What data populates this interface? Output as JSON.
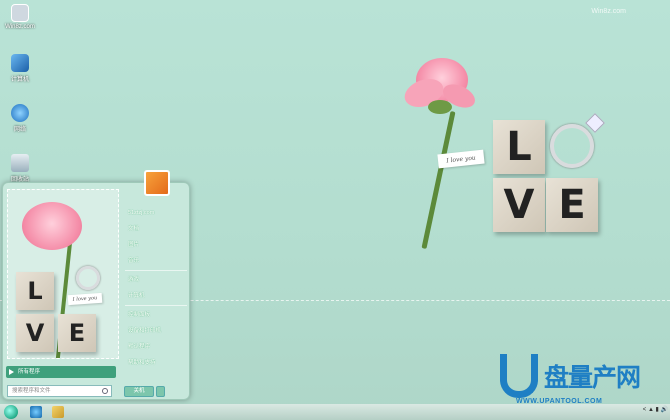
{
  "desktop": {
    "icons": [
      {
        "label": "Win8z.com",
        "name": "site-icon",
        "color": "#cfd8e0"
      },
      {
        "label": "计算机",
        "name": "computer-icon",
        "color": "#2b7fd2"
      },
      {
        "label": "网络",
        "name": "network-icon",
        "color": "#3a9fe0"
      },
      {
        "label": "回收站",
        "name": "recycle-bin-icon",
        "color": "#9ab"
      }
    ],
    "corner_text": "Win8z.com"
  },
  "wallpaper": {
    "letters": [
      "L",
      "V",
      "E"
    ],
    "tag_text": "I love you"
  },
  "start_menu": {
    "items": [
      "51ztzj.com",
      "文档",
      "图片",
      "音乐",
      "游戏",
      "计算机",
      "控制面板",
      "设备和打印机",
      "默认程序",
      "帮助和支持"
    ],
    "thumb_letters": [
      "L",
      "V",
      "E"
    ],
    "thumb_tag": "I love you",
    "all_programs": "所有程序",
    "search_placeholder": "搜索程序和文件",
    "shutdown": "关机"
  },
  "taskbar": {
    "tray_text": "< ▲ ▮ 🔊"
  },
  "watermark": {
    "title": "盘量产网",
    "url": "WWW.UPANTOOL.COM"
  },
  "colors": {
    "accent": "#3fa07c",
    "watermark": "#1f7fc4"
  }
}
